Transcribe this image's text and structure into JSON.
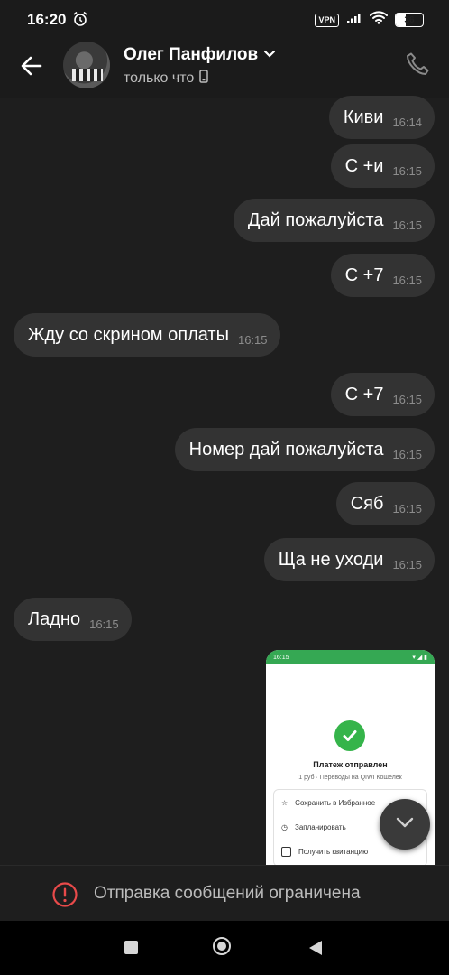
{
  "status_bar": {
    "time": "16:20",
    "vpn_label": "VPN",
    "battery_level": "36",
    "battery_fraction": 0.36
  },
  "header": {
    "contact_name": "Олег Панфилов",
    "status": "только что"
  },
  "messages": [
    {
      "direction": "out",
      "text": "Киви",
      "time": "16:14"
    },
    {
      "direction": "out",
      "text": "С +и",
      "time": "16:15"
    },
    {
      "direction": "out",
      "text": "Дай пожалуйста",
      "time": "16:15"
    },
    {
      "direction": "out",
      "text": "С +7",
      "time": "16:15"
    },
    {
      "direction": "in",
      "text": "Жду со скрином оплаты",
      "time": "16:15"
    },
    {
      "direction": "out",
      "text": "С +7",
      "time": "16:15"
    },
    {
      "direction": "out",
      "text": "Номер дай пожалуйста",
      "time": "16:15"
    },
    {
      "direction": "out",
      "text": "Сяб",
      "time": "16:15"
    },
    {
      "direction": "out",
      "text": "Ща не уходи",
      "time": "16:15"
    },
    {
      "direction": "in",
      "text": "Ладно",
      "time": "16:15"
    }
  ],
  "image_message": {
    "status_time": "16:15",
    "title": "Платеж отправлен",
    "subtitle": "1 руб · Переводы на QIWI Кошелек",
    "actions": [
      "Сохранить в Избранное",
      "Запланировать",
      "Получить квитанцию"
    ]
  },
  "restriction": {
    "text": "Отправка сообщений ограничена"
  },
  "colors": {
    "background": "#1e1e1e",
    "bubble": "#333333",
    "timestamp": "#8c8c8c",
    "warning": "#e84a4a",
    "qiwi_green": "#35a853"
  },
  "icons": {
    "back": "arrow-left-icon",
    "call": "phone-icon",
    "alarm": "alarm-clock-icon",
    "device": "smartphone-icon",
    "chevron": "chevron-down-icon",
    "warning": "exclamation-circle-icon",
    "scroll": "chevron-down-icon"
  }
}
